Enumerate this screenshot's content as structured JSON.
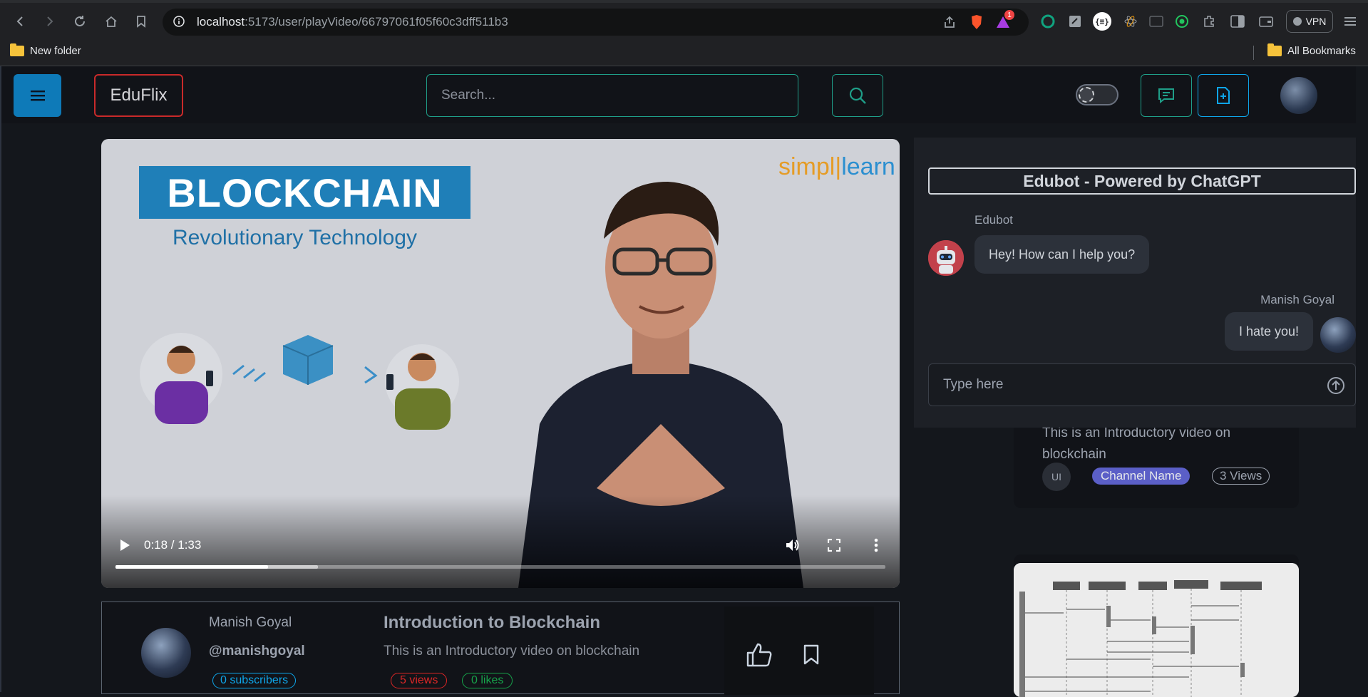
{
  "browser": {
    "url_host": "localhost",
    "url_path": ":5173/user/playVideo/66797061f05f60c3dff511b3",
    "vpn_label": "VPN",
    "brave_badge": "1",
    "bookmarks": [
      {
        "label": "New folder"
      },
      {
        "label": "All Bookmarks"
      }
    ]
  },
  "header": {
    "logo": "EduFlix",
    "search_placeholder": "Search..."
  },
  "video": {
    "banner_title": "BLOCKCHAIN",
    "banner_subtitle": "Revolutionary Technology",
    "watermark_a": "simpl",
    "watermark_b": "learn",
    "time": "0:18 / 1:33",
    "played_fraction": 0.198,
    "buffered_fraction": 0.263
  },
  "info": {
    "owner_name": "Manish Goyal",
    "owner_handle": "@manishgoyal",
    "subscribers": "0 subscribers",
    "title": "Introduction to Blockchain",
    "description": "This is an Introductory video on blockchain",
    "views": "5 views",
    "likes": "0 likes"
  },
  "recommended": {
    "description": "This is an Introductory video on blockchain",
    "avatar_text": "UI",
    "channel": "Channel Name",
    "views": "3 Views"
  },
  "chat": {
    "title": "Edubot - Powered by ChatGPT",
    "bot_name": "Edubot",
    "bot_message": "Hey! How can I help you?",
    "user_name": "Manish Goyal",
    "user_message": "I hate you!",
    "input_placeholder": "Type here"
  },
  "colors": {
    "accent_teal": "#1f9e88",
    "accent_blue": "#0ea5e9",
    "logo_border": "#c92a2a"
  }
}
